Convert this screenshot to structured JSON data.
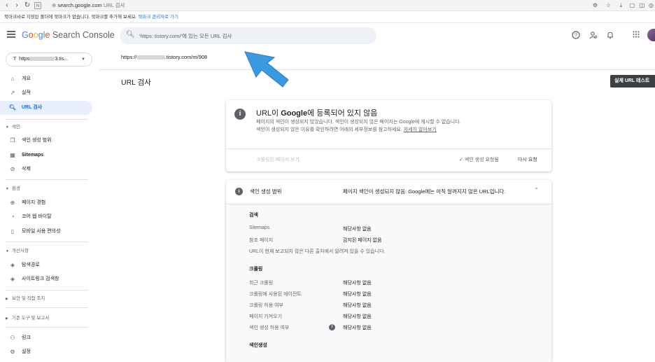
{
  "browser": {
    "url": "search.google.com",
    "page_title": "URL 검사",
    "bookmark_text": "북마크바로 지정된 폴더에 북마크가 없습니다. 북마크를 추가해 보세요.",
    "bookmark_link": "북마크 관리자로 가기"
  },
  "header": {
    "logo_google": [
      "G",
      "o",
      "o",
      "g",
      "l",
      "e"
    ],
    "logo_rest": "Search Console",
    "search_placeholder": "'https:        tistory.com/'에 있는 모든 URL 검사"
  },
  "sidebar": {
    "property_prefix": "https",
    "property_suffix": "3.tis...",
    "items": [
      {
        "label": "개요",
        "icon": "home-icon"
      },
      {
        "label": "실적",
        "icon": "trending-icon"
      },
      {
        "label": "URL 검사",
        "icon": "search-icon"
      }
    ],
    "section_index": "색인",
    "index_items": [
      {
        "label": "색인 생성 범위",
        "icon": "file-copy-icon"
      },
      {
        "label": "Sitemaps",
        "icon": "sitemap-icon"
      },
      {
        "label": "삭제",
        "icon": "visibility-off-icon"
      }
    ],
    "section_experience": "환경",
    "experience_items": [
      {
        "label": "페이지 경험",
        "icon": "plus-circle-icon"
      },
      {
        "label": "코어 웹 바이탈",
        "icon": "speed-icon"
      },
      {
        "label": "모바일 사용 편의성",
        "icon": "smartphone-icon"
      }
    ],
    "section_enhancements": "개선사항",
    "enhancement_items": [
      {
        "label": "탐색경로",
        "icon": "layers-icon"
      },
      {
        "label": "사이트링크 검색창",
        "icon": "layers-icon"
      }
    ],
    "section_security": "보안 및 직접 조치",
    "section_legacy": "기존 도구 및 보고서",
    "bottom_items": [
      {
        "label": "링크",
        "icon": "links-icon"
      },
      {
        "label": "설정",
        "icon": "settings-icon"
      }
    ]
  },
  "main": {
    "inspected_url_prefix": "https://",
    "inspected_url_suffix": ".tistory.com/m/908",
    "page_title": "URL 검사",
    "live_test_label": "실제 URL 테스트"
  },
  "status_card": {
    "title_pre": "URL이 ",
    "title_bold": "Google",
    "title_post": "에 등록되어 있지 않음",
    "description": "페이지의 색인이 생성되지 않았습니다. 색인이 생성되지 않은 페이지는 Google에 게시할 수 없습니다. 색인이 생성되지 않은 이유를 확인하려면 아래의 세부정보를 참고하세요.",
    "learn_more": "자세히 알아보기",
    "crawled_page": "크롤링된 페이지 보기",
    "indexing_requested": "색인 생성 요청됨",
    "retry_request": "다시 요청"
  },
  "coverage": {
    "header_label": "색인 생성 범위",
    "header_value": "페이지 색인이 생성되지 않음: Google에는 아직 알려지지 않은 URL입니다.",
    "discovery_heading": "검색",
    "discovery_rows": [
      {
        "label": "Sitemaps",
        "value": "해당사항 없음"
      },
      {
        "label": "참조 페이지",
        "value": "감지된 페이지 없음"
      }
    ],
    "discovery_note": "URL이 현재 보고되지 않은 다른 출처에서 알려져 있을 수 있습니다.",
    "crawl_heading": "크롤링",
    "crawl_rows": [
      {
        "label": "최근 크롤링",
        "value": "해당사항 없음"
      },
      {
        "label": "크롤링에 사용된 에이전트",
        "value": "해당사항 없음"
      },
      {
        "label": "크롤링 허용 여부",
        "value": "해당사항 없음"
      },
      {
        "label": "페이지 가져오기",
        "value": "해당사항 없음"
      },
      {
        "label": "색인 생성 허용 여부",
        "value": "해당사항 없음"
      }
    ],
    "indexing_heading": "색인생성"
  },
  "colors": {
    "accent": "#1a73e8",
    "active_bg": "#e8f0fe",
    "arrow": "#3a9ae0"
  }
}
